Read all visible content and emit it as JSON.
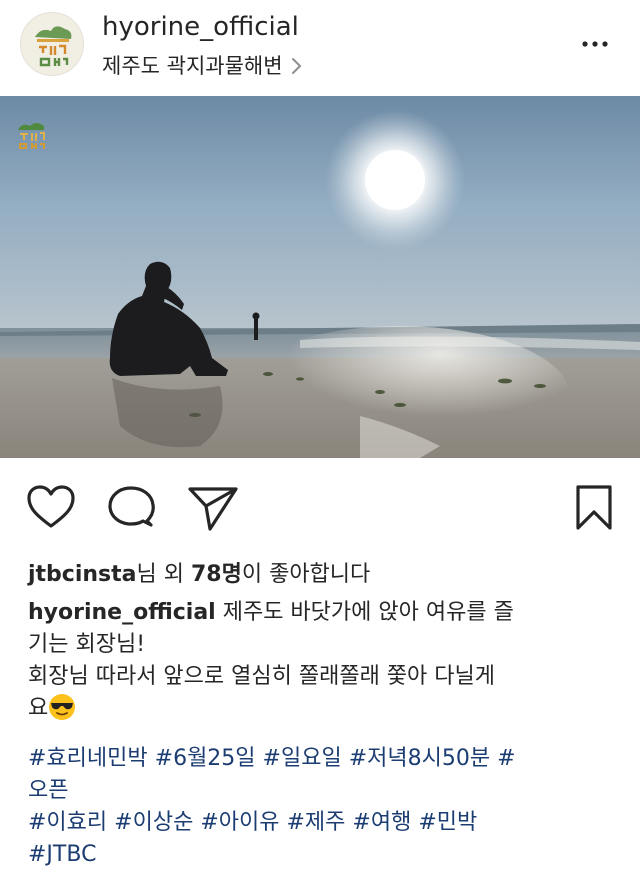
{
  "header": {
    "username": "hyorine_official",
    "location": "제주도 곽지과물해변",
    "avatar_logo_text": "효리네 민박"
  },
  "photo": {
    "watermark_text": "효리네 민박"
  },
  "likes": {
    "user": "jtbcinsta",
    "mid": "님 외 ",
    "count": "78명",
    "suffix": "이 좋아합니다"
  },
  "caption": {
    "user": "hyorine_official",
    "line1": " 제주도 바닷가에 앉아 여유를 즐",
    "line2": "기는 회장님!",
    "line3": "회장님 따라서 앞으로 열심히 쫄래쫄래 쫓아 다닐게",
    "line4": "요",
    "emoji": "sunglasses-emoji"
  },
  "hashtags": {
    "line1": [
      "#효리네민박",
      "#6월25일",
      "#일요일",
      "#저녁8시50분",
      "#"
    ],
    "line2": [
      "오픈"
    ],
    "line3": [
      "#이효리",
      "#이상순",
      "#아이유",
      "#제주",
      "#여행",
      "#민박"
    ],
    "line4": [
      "#JTBC"
    ]
  },
  "colors": {
    "text": "#262626",
    "hashtag": "#1c3d72",
    "sky": "#8aa7bd",
    "sand": "#9b968d"
  },
  "icons": [
    "more-options-icon",
    "heart-icon",
    "comment-icon",
    "share-icon",
    "bookmark-icon",
    "chevron-right-icon"
  ]
}
